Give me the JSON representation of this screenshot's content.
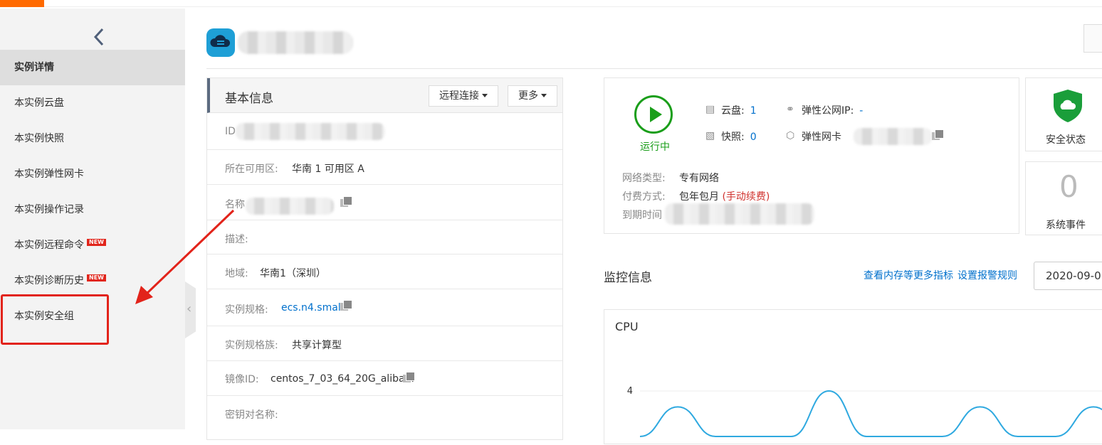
{
  "sidebar": {
    "items": [
      {
        "label": "实例详情",
        "active": true
      },
      {
        "label": "本实例云盘"
      },
      {
        "label": "本实例快照"
      },
      {
        "label": "本实例弹性网卡"
      },
      {
        "label": "本实例操作记录"
      },
      {
        "label": "本实例远程命令",
        "badge": "NEW"
      },
      {
        "label": "本实例诊断历史",
        "badge": "NEW"
      },
      {
        "label": "本实例安全组",
        "highlighted": true
      }
    ]
  },
  "basic_info": {
    "title": "基本信息",
    "remote_connect_label": "远程连接",
    "more_label": "更多",
    "rows": {
      "id_label": "ID",
      "zone_label": "所在可用区:",
      "zone_value": "华南 1 可用区 A",
      "name_label": "名称",
      "desc_label": "描述:",
      "region_label": "地域:",
      "region_value": "华南1（深圳）",
      "spec_label": "实例规格:",
      "spec_value": "ecs.n4.small",
      "family_label": "实例规格族:",
      "family_value": "共享计算型",
      "image_label": "镜像ID:",
      "image_value": "centos_7_03_64_20G_aliba...",
      "keypair_label": "密钥对名称:"
    }
  },
  "status": {
    "running_label": "运行中",
    "disk_label": "云盘:",
    "disk_count": "1",
    "snapshot_label": "快照:",
    "snapshot_count": "0",
    "eip_label": "弹性公网IP:",
    "eip_value": "-",
    "eni_label": "弹性网卡",
    "network_label": "网络类型:",
    "network_value": "专有网络",
    "billing_label": "付费方式:",
    "billing_value": "包年包月",
    "billing_note": "(手动续费)",
    "expire_label": "到期时间"
  },
  "security": {
    "label": "安全状态"
  },
  "events": {
    "count": "0",
    "label": "系统事件"
  },
  "monitor": {
    "title": "监控信息",
    "link_more": "查看内存等更多指标",
    "link_alarm": "设置报警规则",
    "date_value": "2020-09-0"
  },
  "chart_data": {
    "type": "line",
    "title": "CPU",
    "ytick_visible": "4",
    "series": [
      {
        "values": [
          0,
          2.6,
          0,
          0,
          0,
          4,
          0,
          0,
          0,
          2.6,
          0,
          0,
          2.6,
          0
        ]
      }
    ],
    "colors": {
      "line": "#2fa9e0"
    }
  },
  "colors": {
    "accent": "#ff6a00",
    "link": "#0070cc",
    "running": "#1a9e1a",
    "alert": "#e2231a"
  }
}
